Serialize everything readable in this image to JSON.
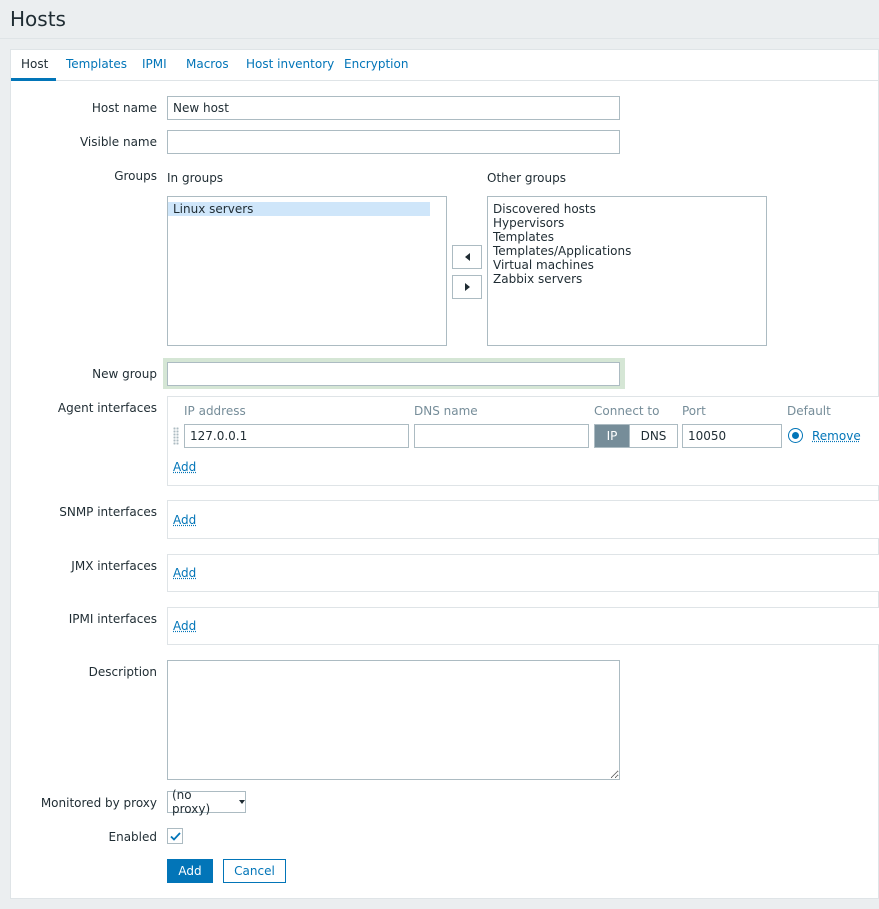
{
  "page": {
    "title": "Hosts"
  },
  "tabs": [
    {
      "label": "Host",
      "active": true
    },
    {
      "label": "Templates"
    },
    {
      "label": "IPMI"
    },
    {
      "label": "Macros"
    },
    {
      "label": "Host inventory"
    },
    {
      "label": "Encryption"
    }
  ],
  "form": {
    "host_name": {
      "label": "Host name",
      "value": "New host"
    },
    "visible_name": {
      "label": "Visible name",
      "value": ""
    },
    "groups": {
      "label": "Groups",
      "in_groups_label": "In groups",
      "other_groups_label": "Other groups",
      "in_groups": [
        "Linux servers"
      ],
      "other_groups": [
        "Discovered hosts",
        "Hypervisors",
        "Templates",
        "Templates/Applications",
        "Virtual machines",
        "Zabbix servers"
      ]
    },
    "new_group": {
      "label": "New group",
      "value": ""
    },
    "agent_interfaces": {
      "label": "Agent interfaces",
      "headers": {
        "ip": "IP address",
        "dns": "DNS name",
        "connect_to": "Connect to",
        "port": "Port",
        "default": "Default"
      },
      "row": {
        "ip": "127.0.0.1",
        "dns": "",
        "connect_ip": "IP",
        "connect_dns": "DNS",
        "port": "10050",
        "remove": "Remove"
      },
      "add": "Add"
    },
    "snmp_interfaces": {
      "label": "SNMP interfaces",
      "add": "Add"
    },
    "jmx_interfaces": {
      "label": "JMX interfaces",
      "add": "Add"
    },
    "ipmi_interfaces": {
      "label": "IPMI interfaces",
      "add": "Add"
    },
    "description": {
      "label": "Description",
      "value": ""
    },
    "proxy": {
      "label": "Monitored by proxy",
      "selected": "(no proxy)"
    },
    "enabled": {
      "label": "Enabled",
      "checked": true
    },
    "buttons": {
      "add": "Add",
      "cancel": "Cancel"
    }
  },
  "colors": {
    "accent": "#0275b8",
    "text": "#1f2c33",
    "muted": "#768d99",
    "border": "#acbbc2",
    "background": "#ebeef0"
  }
}
